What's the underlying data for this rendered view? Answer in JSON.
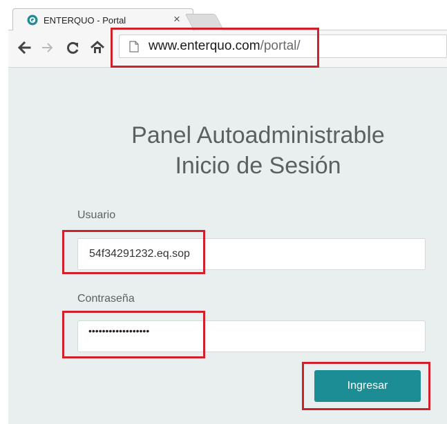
{
  "browser": {
    "tab_title": "ENTERQUO - Portal",
    "tab_close": "×",
    "url_host": "www.enterquo.com",
    "url_path": "/portal/"
  },
  "login": {
    "heading_line1": "Panel Autoadministrable",
    "heading_line2": "Inicio de Sesión",
    "username_label": "Usuario",
    "username_value": "54f34291232.eq.sop",
    "password_label": "Contraseña",
    "password_mask": "••••••••••••••••••",
    "submit_label": "Ingresar"
  },
  "colors": {
    "page_background": "#e9eeee",
    "accent_button": "#1d8d95",
    "highlight_red": "#d0202b",
    "heading_text": "#5a6163"
  }
}
